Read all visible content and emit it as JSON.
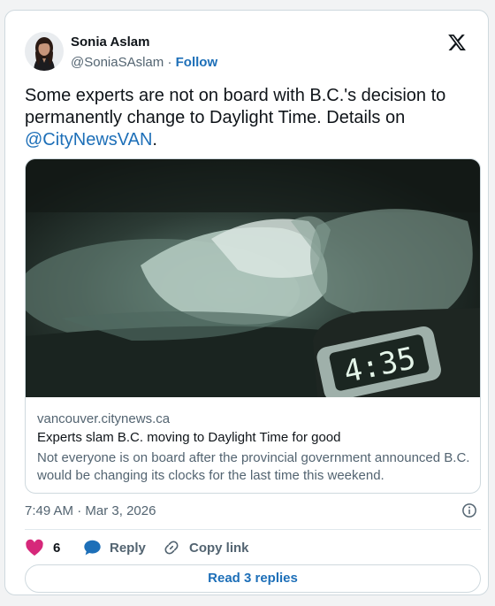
{
  "author": {
    "name": "Sonia Aslam",
    "handle": "@SoniaSAslam",
    "separator": "·",
    "follow_label": "Follow"
  },
  "tweet": {
    "text_before": "Some experts are not on board with B.C.'s decision to permanently change to Daylight Time. Details on ",
    "mention": "@CityNewsVAN",
    "text_after": "."
  },
  "link_card": {
    "image_icon": "clock-photo",
    "clock_display": "4:35",
    "domain": "vancouver.citynews.ca",
    "title": "Experts slam B.C. moving to Daylight Time for good",
    "description": "Not everyone is on board after the provincial government announced B.C. would be changing its clocks for the last time this weekend."
  },
  "meta": {
    "time": "7:49 AM",
    "separator": "·",
    "date": "Mar 3, 2026"
  },
  "actions": {
    "like_count": "6",
    "reply_label": "Reply",
    "copy_link_label": "Copy link"
  },
  "read_replies_label": "Read 3 replies",
  "colors": {
    "accent": "#1d6fb8",
    "like": "#d6287a",
    "text_secondary": "#536471",
    "border": "#cfd9de"
  }
}
